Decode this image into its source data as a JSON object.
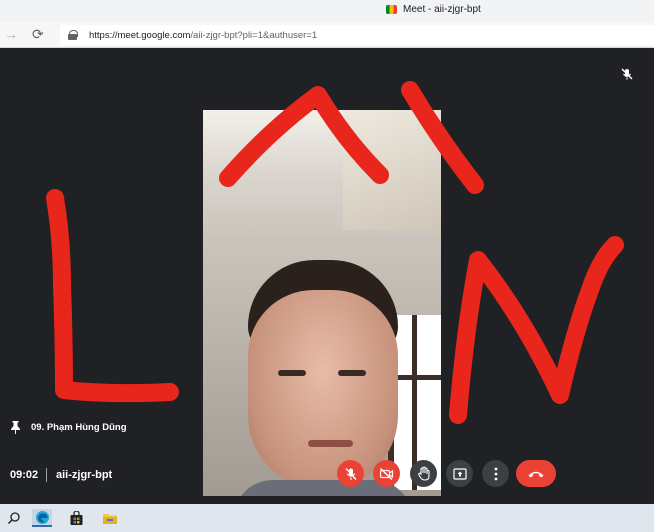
{
  "browser": {
    "tab_title": "Meet - aii-zjgr-bpt",
    "url_host": "https://meet.google.com",
    "url_path": "/aii-zjgr-bpt?pli=1&authuser=1"
  },
  "participant": {
    "name": "09. Phạm Hùng Dũng"
  },
  "meeting": {
    "time": "09:02",
    "code": "aii-zjgr-bpt"
  },
  "controls": [
    {
      "name": "mic-off-button",
      "state": "off",
      "color": "#ea4335"
    },
    {
      "name": "camera-off-button",
      "state": "off",
      "color": "#ea4335"
    },
    {
      "name": "raise-hand-button",
      "color": "#3c4043"
    },
    {
      "name": "present-button",
      "color": "#3c4043"
    },
    {
      "name": "more-options-button",
      "color": "#3c4043"
    },
    {
      "name": "leave-call-button",
      "color": "#ea4335"
    }
  ],
  "taskbar": {
    "icons": [
      "search-icon",
      "edge-browser-icon",
      "store-icon",
      "file-explorer-icon"
    ]
  },
  "colors": {
    "background": "#202124",
    "danger": "#ea4335",
    "control_grey": "#3c4043",
    "marker_red": "#e8261b"
  }
}
